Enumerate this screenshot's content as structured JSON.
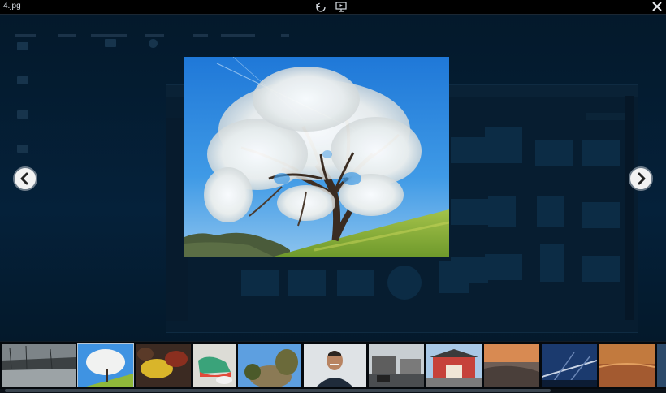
{
  "window": {
    "title": "4.jpg",
    "rotate_icon": "rotate-icon",
    "slideshow_icon": "slideshow-icon",
    "close_icon": "close-icon"
  },
  "navigation": {
    "previous_icon": "chevron-left-icon",
    "next_icon": "chevron-right-icon"
  },
  "viewer": {
    "current_image": "blossoming-tree-photo"
  },
  "filmstrip": {
    "thumbnails": [
      {
        "subject": "winter-river"
      },
      {
        "subject": "blossoming-tree",
        "selected": true
      },
      {
        "subject": "autumn-leaves"
      },
      {
        "subject": "sneakers"
      },
      {
        "subject": "rocky-hill"
      },
      {
        "subject": "portrait-man"
      },
      {
        "subject": "city-street"
      },
      {
        "subject": "red-temple"
      },
      {
        "subject": "sunset-coast"
      },
      {
        "subject": "bridge-night"
      },
      {
        "subject": "orange-sky"
      }
    ]
  },
  "colors": {
    "backdrop": "#031626",
    "topbar": "#000000",
    "sky": "#2f8fe0",
    "grass": "#8fb83a"
  }
}
